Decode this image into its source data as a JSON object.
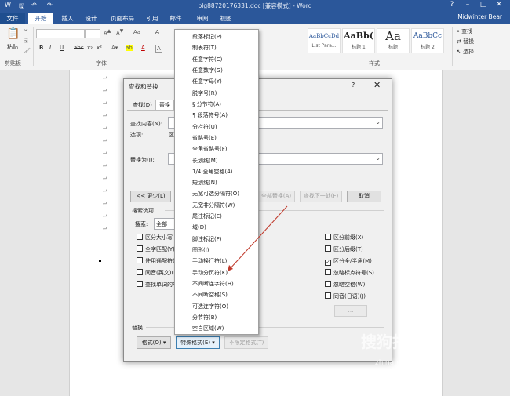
{
  "window": {
    "title": "blg88720176331.doc [兼容模式] - Word",
    "user": "Midwinter Bear"
  },
  "qat": {
    "save": "🖫",
    "undo": "↶",
    "redo": "↷"
  },
  "tabs": {
    "file": "文件",
    "home": "开始",
    "insert": "插入",
    "design": "设计",
    "layout": "页面布局",
    "refs": "引用",
    "mail": "邮件",
    "review": "审阅",
    "view": "视图"
  },
  "ribbon": {
    "paste": "粘贴",
    "clipboard": "剪贴板",
    "font": "字体",
    "styles": "样式",
    "find": "查找",
    "replace": "替换",
    "select": "选择",
    "bold": "B",
    "italic": "I",
    "underline": "U",
    "strike": "abc",
    "sub": "x₂",
    "sup": "x²",
    "aa": "Aa",
    "font_a": "A",
    "style1_big": "AaBbCcDd",
    "style1_name": "List Para...",
    "style2_big": "AaBb(",
    "style2_name": "标题 1",
    "style3_big": "Aa",
    "style3_name": "标题",
    "style4_big": "AaBbCc",
    "style4_name": "标题 2"
  },
  "dialog": {
    "title": "查找和替换",
    "help": "?",
    "close": "✕",
    "tab_find": "查找(D)",
    "tab_replace": "替换",
    "find_label": "查找内容(N):",
    "options_label": "选项:",
    "options_value": "区分",
    "replace_label": "替换为(I):",
    "less_btn": "<< 更少(L)",
    "replace_all": "全部替换(A)",
    "find_next": "查找下一处(F)",
    "cancel": "取消",
    "search_options": "搜索选项",
    "search_label": "搜索:",
    "search_value": "全部",
    "left_checks": [
      "区分大小写",
      "全字匹配(Y)",
      "使用通配符(U)",
      "同音(英文)(K)",
      "查找单词的所"
    ],
    "right_checks": [
      "区分前缀(X)",
      "区分后缀(T)",
      "区分全/半角(M)",
      "忽略标点符号(S)",
      "忽略空格(W)",
      "同音(日语)(J)"
    ],
    "right_checked": [
      false,
      false,
      true,
      false,
      false,
      false
    ],
    "replace_section": "替换",
    "format_btn": "格式(O) ▾",
    "special_btn": "特殊格式(E) ▾",
    "no_format_btn": "不限定格式(T)"
  },
  "menu": {
    "items": [
      "段落标记(P)",
      "制表符(T)",
      "任意字符(C)",
      "任意数字(G)",
      "任意字母(Y)",
      "脱字号(R)",
      "§ 分节符(A)",
      "¶ 段落符号(A)",
      "分栏符(U)",
      "省略号(E)",
      "全角省略号(F)",
      "长划线(M)",
      "1/4 全角空格(4)",
      "短划线(N)",
      "无宽可选分隔符(O)",
      "无宽非分隔符(W)",
      "尾注标记(E)",
      "域(D)",
      "脚注标记(F)",
      "图形(I)",
      "手动换行符(L)",
      "手动分页符(K)",
      "不间断连字符(H)",
      "不间断空格(S)",
      "可选连字符(O)",
      "分节符(B)",
      "空白区域(W)"
    ]
  },
  "watermark": {
    "main": "搜狗指南",
    "sub": "zhinan.sogou.com"
  },
  "para_mark": "↵"
}
